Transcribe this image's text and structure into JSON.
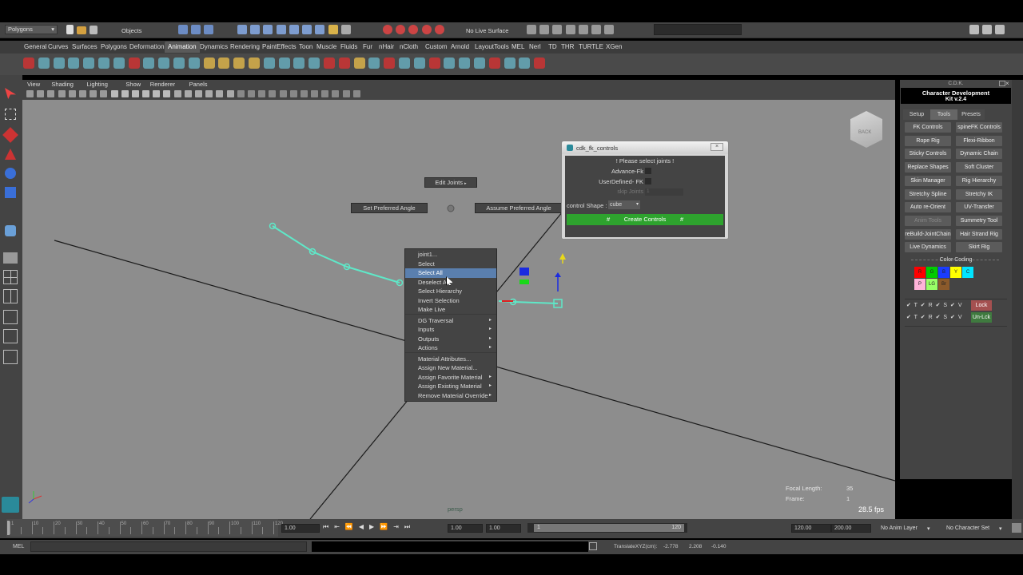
{
  "status_line": {
    "mode": "Polygons",
    "objects_label": "Objects",
    "live_surface": "No Live Surface"
  },
  "shelf_tabs": [
    "General",
    "Curves",
    "Surfaces",
    "Polygons",
    "Deformation",
    "Animation",
    "Dynamics",
    "Rendering",
    "PaintEffects",
    "Toon",
    "Muscle",
    "Fluids",
    "Fur",
    "nHair",
    "nCloth",
    "Custom",
    "Arnold",
    "LayoutTools",
    "MEL",
    "Nerl",
    "TD",
    "THR",
    "TURTLE",
    "XGen"
  ],
  "active_shelf_tab": "Animation",
  "viewport_menu": [
    "View",
    "Shading",
    "Lighting",
    "Show",
    "Renderer",
    "Panels"
  ],
  "viewport": {
    "camera_label": "persp",
    "view_cube_label": "BACK",
    "hud": {
      "focal_length_label": "Focal Length:",
      "focal_length_value": "35",
      "frame_label": "Frame:",
      "frame_value": "1",
      "fps": "28.5 fps"
    }
  },
  "marking_menu": {
    "edit_joints": "Edit Joints",
    "set_preferred_angle": "Set Preferred Angle",
    "assume_preferred_angle": "Assume Preferred Angle"
  },
  "context_menu": {
    "items": [
      {
        "label": "joint1...",
        "arrow": false
      },
      {
        "label": "Select",
        "arrow": false
      },
      {
        "label": "Select All",
        "arrow": false
      },
      {
        "label": "Deselect All",
        "arrow": false
      },
      {
        "label": "Select Hierarchy",
        "arrow": false
      },
      {
        "label": "Invert Selection",
        "arrow": false
      },
      {
        "label": "Make Live",
        "arrow": false
      },
      {
        "label": "DG Traversal",
        "arrow": true
      },
      {
        "label": "Inputs",
        "arrow": true
      },
      {
        "label": "Outputs",
        "arrow": true
      },
      {
        "label": "Actions",
        "arrow": true
      },
      {
        "label": "Material Attributes...",
        "arrow": false
      },
      {
        "label": "Assign New Material...",
        "arrow": false
      },
      {
        "label": "Assign Favorite Material",
        "arrow": true
      },
      {
        "label": "Assign Existing Material",
        "arrow": true
      },
      {
        "label": "Remove Material Override",
        "arrow": true
      }
    ],
    "highlighted": "Select All"
  },
  "fk_dialog": {
    "title": "cdk_fk_controls",
    "message": "! Please select joints !",
    "advance_fk": "Advance-Fk",
    "userdefined_fk": "UserDefined- FK",
    "skip_joints": "skip Joints",
    "skip_joints_value": "1",
    "control_shape_label": "control Shape :",
    "control_shape_value": "cube",
    "create_button": "Create Controls",
    "hash": "#"
  },
  "cdk_panel": {
    "header": "C.D.K.",
    "title_line1": "Character Development",
    "title_line2": "Kit v.2.4",
    "tabs": [
      "Setup",
      "Tools",
      "Presets"
    ],
    "active_tab": "Tools",
    "buttons_left": [
      "FK Controls",
      "Rope Rig",
      "Sticky Controls",
      "Replace Shapes",
      "Skin Manager",
      "Stretchy Spline",
      "Auto re-Orient",
      "Anim Tools",
      "reBuild-JointChain",
      "Live Dynamics"
    ],
    "buttons_right": [
      "spineFK Controls",
      "Flexi-Ribbon",
      "Dynamic Chain",
      "Soft Cluster",
      "Rig Hierarchy",
      "Stretchy IK",
      "UV-Transfer",
      "Summetry Tool",
      "Hair Strand Rig",
      "Skirt Rig"
    ],
    "dim_button": "Anim Tools",
    "color_coding_label": "Color Coding",
    "swatches": [
      {
        "label": "R",
        "color": "#ff0000"
      },
      {
        "label": "G",
        "color": "#00cc00"
      },
      {
        "label": "B",
        "color": "#1a3cff"
      },
      {
        "label": "Y",
        "color": "#ffff00"
      },
      {
        "label": "C",
        "color": "#00e5ff"
      },
      {
        "label": "P",
        "color": "#ffb3d9"
      },
      {
        "label": "LG",
        "color": "#99ff66"
      },
      {
        "label": "Br",
        "color": "#8b5a2b"
      }
    ],
    "lock_row_labels": "✔ T ✔ R ✔ S ✔ V",
    "lock_button": "Lock",
    "unlock_button": "Un-Lck"
  },
  "timeline": {
    "ticks": [
      "1",
      "5",
      "10",
      "15",
      "20",
      "25",
      "30",
      "35",
      "40",
      "45",
      "50",
      "55",
      "60",
      "65",
      "70",
      "75",
      "80",
      "85",
      "90",
      "95",
      "100",
      "105",
      "110",
      "115",
      "120"
    ],
    "current_frame": "1.00",
    "range_start": "1.00",
    "range_start2": "1.00",
    "range_slider_start": "1",
    "range_slider_end": "120",
    "range_end": "120.00",
    "anim_end": "200.00",
    "anim_layer": "No Anim Layer",
    "character_set": "No Character Set"
  },
  "command_line": {
    "mel_label": "MEL",
    "translate_label": "TranslateXYZ(cm):",
    "tx": "-2.778",
    "ty": "2.208",
    "tz": "-0.140"
  }
}
